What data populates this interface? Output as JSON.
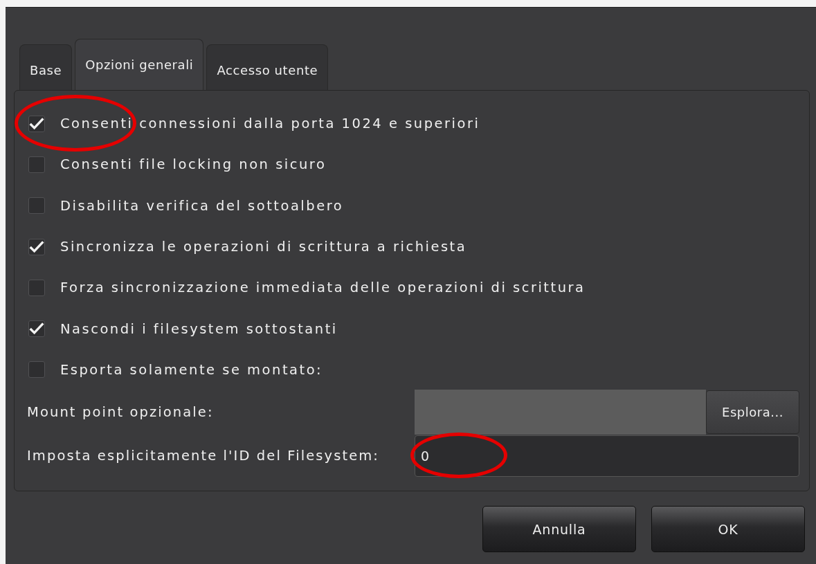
{
  "tabs": [
    {
      "label": "Base",
      "selected": false
    },
    {
      "label": "Opzioni generali",
      "selected": true
    },
    {
      "label": "Accesso utente",
      "selected": false
    }
  ],
  "options": [
    {
      "label": "Consenti connessioni dalla porta 1024 e superiori",
      "checked": true,
      "circled": true
    },
    {
      "label": "Consenti file locking non sicuro",
      "checked": false,
      "circled": false
    },
    {
      "label": "Disabilita verifica del sottoalbero",
      "checked": false,
      "circled": false
    },
    {
      "label": "Sincronizza le operazioni di scrittura a richiesta",
      "checked": true,
      "circled": false
    },
    {
      "label": "Forza sincronizzazione immediata delle operazioni di scrittura",
      "checked": false,
      "circled": false
    },
    {
      "label": "Nascondi i filesystem sottostanti",
      "checked": true,
      "circled": false
    },
    {
      "label": "Esporta solamente se montato:",
      "checked": false,
      "circled": false
    }
  ],
  "mount_point": {
    "label": "Mount point opzionale:",
    "disabled": true,
    "browse_button": "Esplora..."
  },
  "filesystem_id": {
    "label": "Imposta esplicitamente l'ID del Filesystem:",
    "value": "0",
    "circled": true
  },
  "buttons": [
    "Annulla",
    "OK"
  ]
}
